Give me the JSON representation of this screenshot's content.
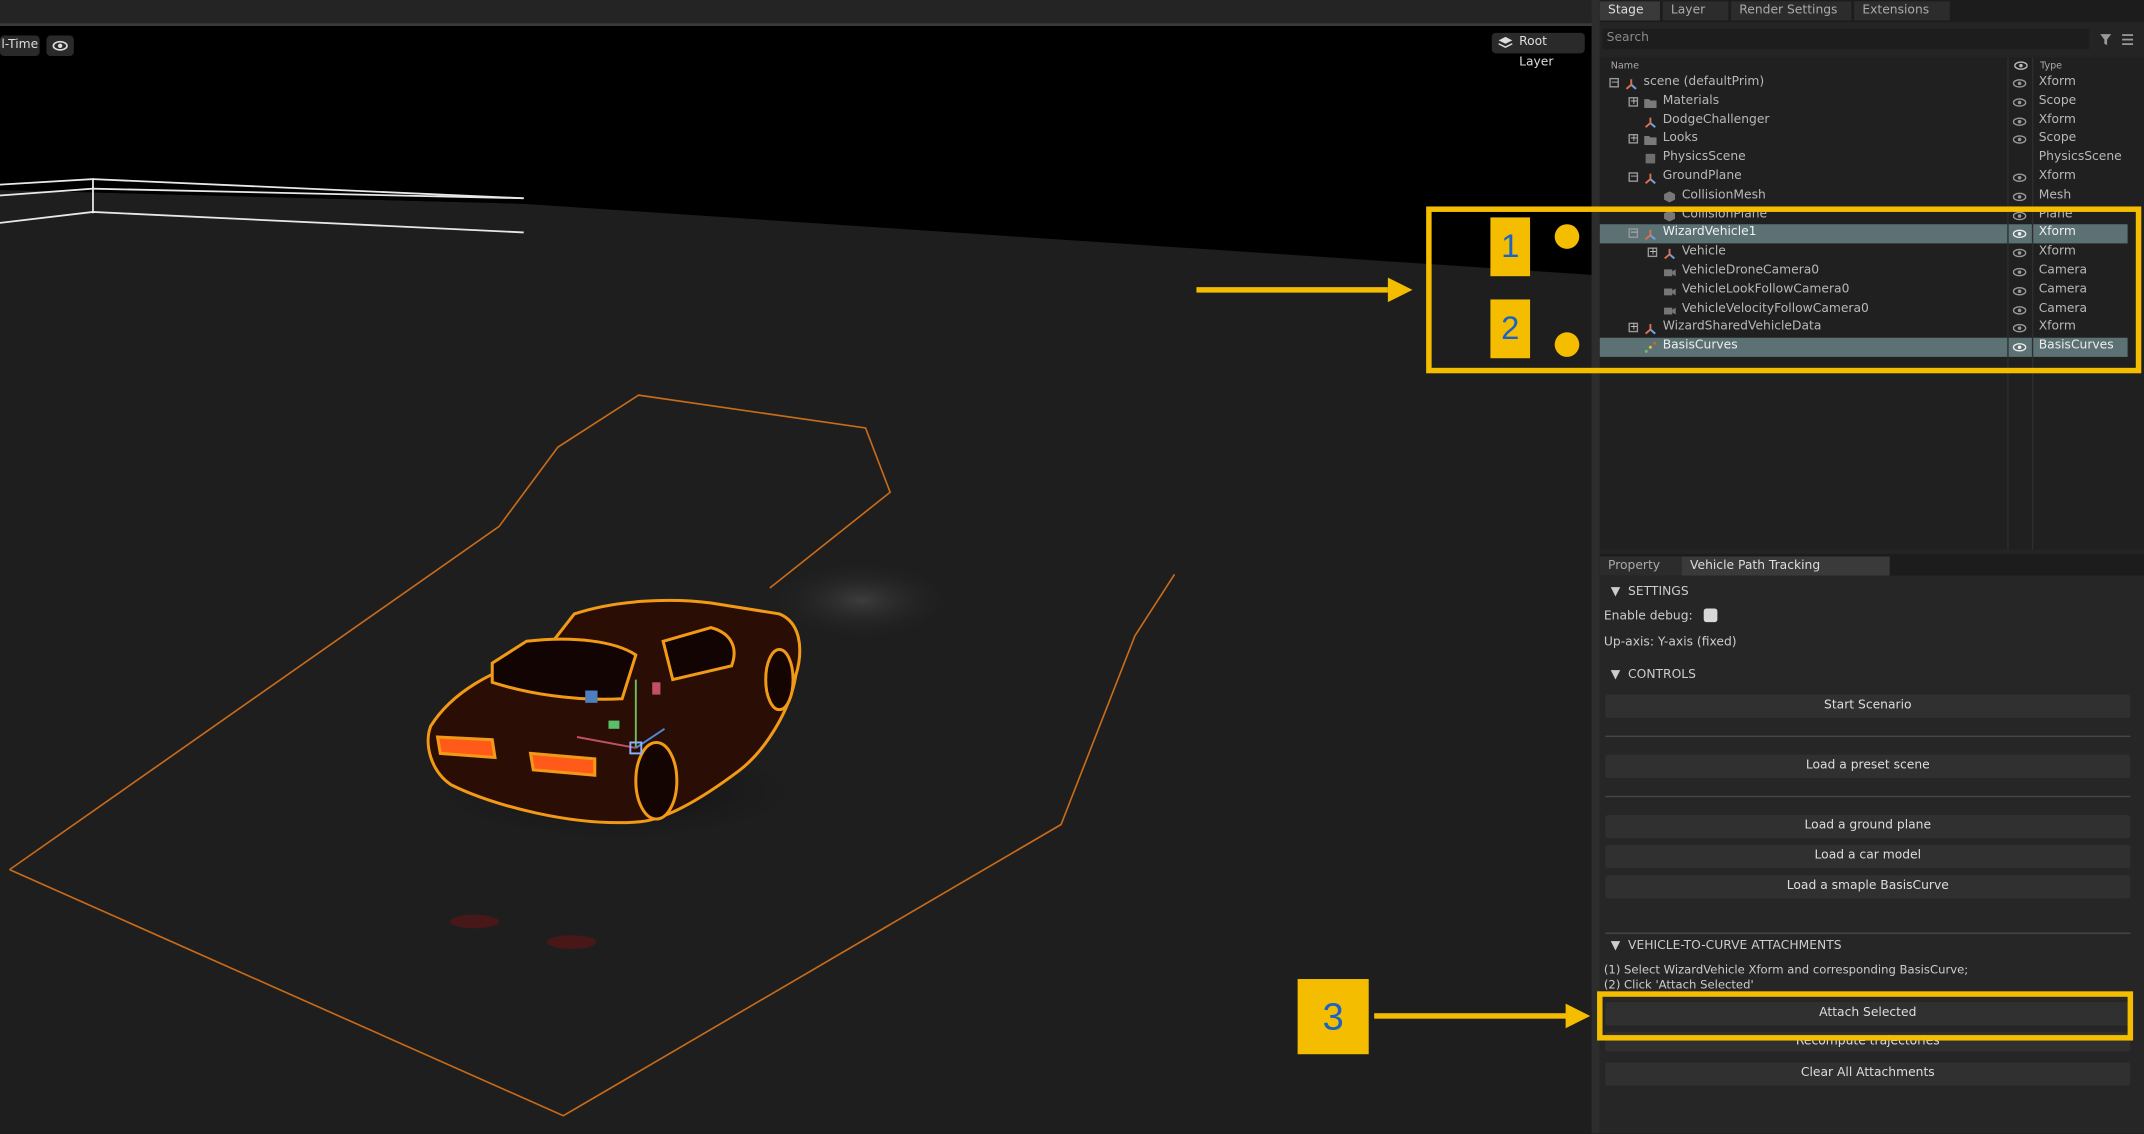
{
  "viewport": {
    "realtime_label": "l-Time",
    "root_layer_label": "Root Layer",
    "eye_icon": "eye-icon",
    "layers_icon": "layers-icon"
  },
  "stage": {
    "tabs": [
      "Stage",
      "Layer",
      "Render Settings",
      "Extensions"
    ],
    "active_tab": "Stage",
    "search_placeholder": "Search",
    "columns": {
      "name": "Name",
      "type": "Type"
    },
    "rows": [
      {
        "name": "scene (defaultPrim)",
        "type": "Xform",
        "depth": 0,
        "expander": "minus",
        "icon": "xform-icon",
        "visible": true,
        "selected": false
      },
      {
        "name": "Materials",
        "type": "Scope",
        "depth": 1,
        "expander": "plus",
        "icon": "folder-icon",
        "visible": true,
        "selected": false
      },
      {
        "name": "DodgeChallenger",
        "type": "Xform",
        "depth": 1,
        "expander": "none",
        "icon": "xform-icon",
        "visible": true,
        "selected": false
      },
      {
        "name": "Looks",
        "type": "Scope",
        "depth": 1,
        "expander": "plus",
        "icon": "folder-icon",
        "visible": true,
        "selected": false
      },
      {
        "name": "PhysicsScene",
        "type": "PhysicsScene",
        "depth": 1,
        "expander": "none",
        "icon": "physics-icon",
        "visible": false,
        "selected": false
      },
      {
        "name": "GroundPlane",
        "type": "Xform",
        "depth": 1,
        "expander": "minus",
        "icon": "xform-icon",
        "visible": true,
        "selected": false
      },
      {
        "name": "CollisionMesh",
        "type": "Mesh",
        "depth": 2,
        "expander": "none",
        "icon": "mesh-icon",
        "visible": true,
        "selected": false
      },
      {
        "name": "CollisionPlane",
        "type": "Plane",
        "depth": 2,
        "expander": "none",
        "icon": "mesh-icon",
        "visible": true,
        "selected": false
      },
      {
        "name": "WizardVehicle1",
        "type": "Xform",
        "depth": 1,
        "expander": "minus",
        "icon": "xform-icon",
        "visible": true,
        "selected": true
      },
      {
        "name": "Vehicle",
        "type": "Xform",
        "depth": 2,
        "expander": "plus",
        "icon": "xform-icon",
        "visible": true,
        "selected": false
      },
      {
        "name": "VehicleDroneCamera0",
        "type": "Camera",
        "depth": 2,
        "expander": "none",
        "icon": "camera-icon",
        "visible": true,
        "selected": false
      },
      {
        "name": "VehicleLookFollowCamera0",
        "type": "Camera",
        "depth": 2,
        "expander": "none",
        "icon": "camera-icon",
        "visible": true,
        "selected": false
      },
      {
        "name": "VehicleVelocityFollowCamera0",
        "type": "Camera",
        "depth": 2,
        "expander": "none",
        "icon": "camera-icon",
        "visible": true,
        "selected": false
      },
      {
        "name": "WizardSharedVehicleData",
        "type": "Xform",
        "depth": 1,
        "expander": "plus",
        "icon": "xform-icon",
        "visible": true,
        "selected": false
      },
      {
        "name": "BasisCurves",
        "type": "BasisCurves",
        "depth": 1,
        "expander": "none",
        "icon": "curve-icon",
        "visible": true,
        "selected": true
      }
    ]
  },
  "property": {
    "tabs": [
      "Property",
      "Vehicle Path Tracking Extension"
    ],
    "active_tab": "Vehicle Path Tracking Extension",
    "settings_header": "SETTINGS",
    "enable_debug_label": "Enable debug:",
    "up_axis_label": "Up-axis: Y-axis (fixed)",
    "controls_header": "CONTROLS",
    "start_scenario": "Start Scenario",
    "load_preset_scene": "Load a preset scene",
    "load_ground_plane": "Load a ground plane",
    "load_car_model": "Load a car model",
    "load_basis_curve": "Load a smaple BasisCurve",
    "attachments_header": "VEHICLE-TO-CURVE ATTACHMENTS",
    "instruction_1": "(1) Select WizardVehicle Xform and corresponding BasisCurve;",
    "instruction_2": "(2) Click 'Attach Selected'",
    "attach_selected": "Attach Selected",
    "recompute_trajectories": "Recompute trajectories",
    "clear_all_attachments": "Clear All Attachments"
  },
  "annotations": {
    "label_1": "1",
    "label_2": "2",
    "label_3": "3",
    "color": "#f5bd00",
    "text_color": "#1a63c8"
  }
}
